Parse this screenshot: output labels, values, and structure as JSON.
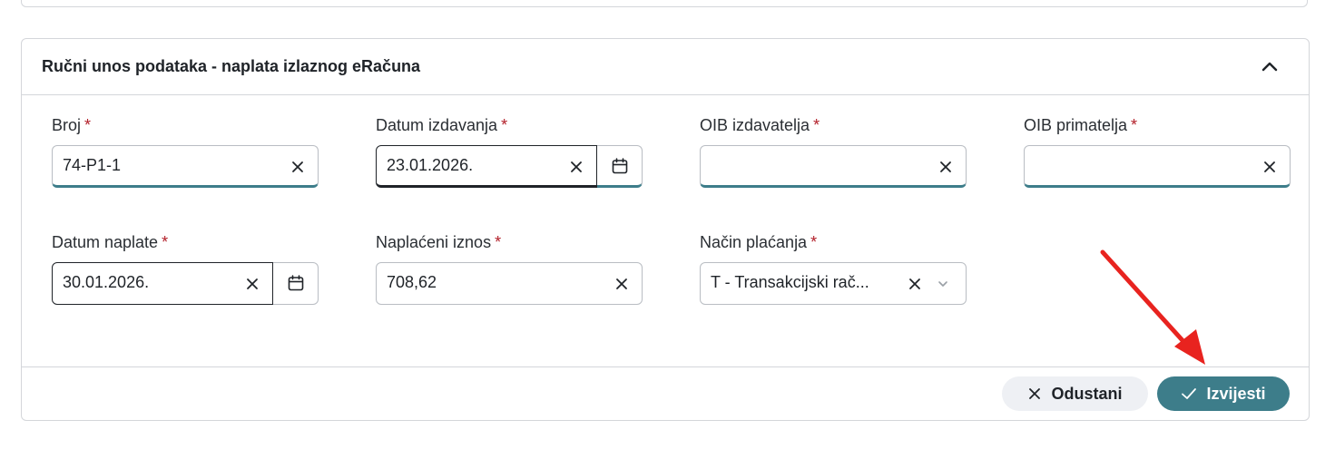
{
  "section": {
    "title": "Ručni unos podataka - naplata izlaznog eRačuna"
  },
  "fields": {
    "broj": {
      "label": "Broj",
      "value": "74-P1-1"
    },
    "datum_izdavanja": {
      "label": "Datum izdavanja",
      "value": "23.01.2026."
    },
    "oib_izdavatelja": {
      "label": "OIB izdavatelja",
      "value": ""
    },
    "oib_primatelja": {
      "label": "OIB primatelja",
      "value": ""
    },
    "datum_naplate": {
      "label": "Datum naplate",
      "value": "30.01.2026."
    },
    "naplaceni_iznos": {
      "label": "Naplaćeni iznos",
      "value": "708,62"
    },
    "nacin_placanja": {
      "label": "Način plaćanja",
      "value": "T - Transakcijski rač..."
    }
  },
  "required_marker": "*",
  "buttons": {
    "cancel": "Odustani",
    "submit": "Izvijesti"
  },
  "colors": {
    "accent": "#3d7d8a",
    "required": "#b3202a",
    "annotation_arrow": "#e8231f"
  },
  "icons": {
    "collapse": "chevron-up-icon",
    "clear": "close-icon",
    "calendar": "calendar-icon",
    "dropdown": "chevron-down-icon",
    "check": "check-icon"
  }
}
